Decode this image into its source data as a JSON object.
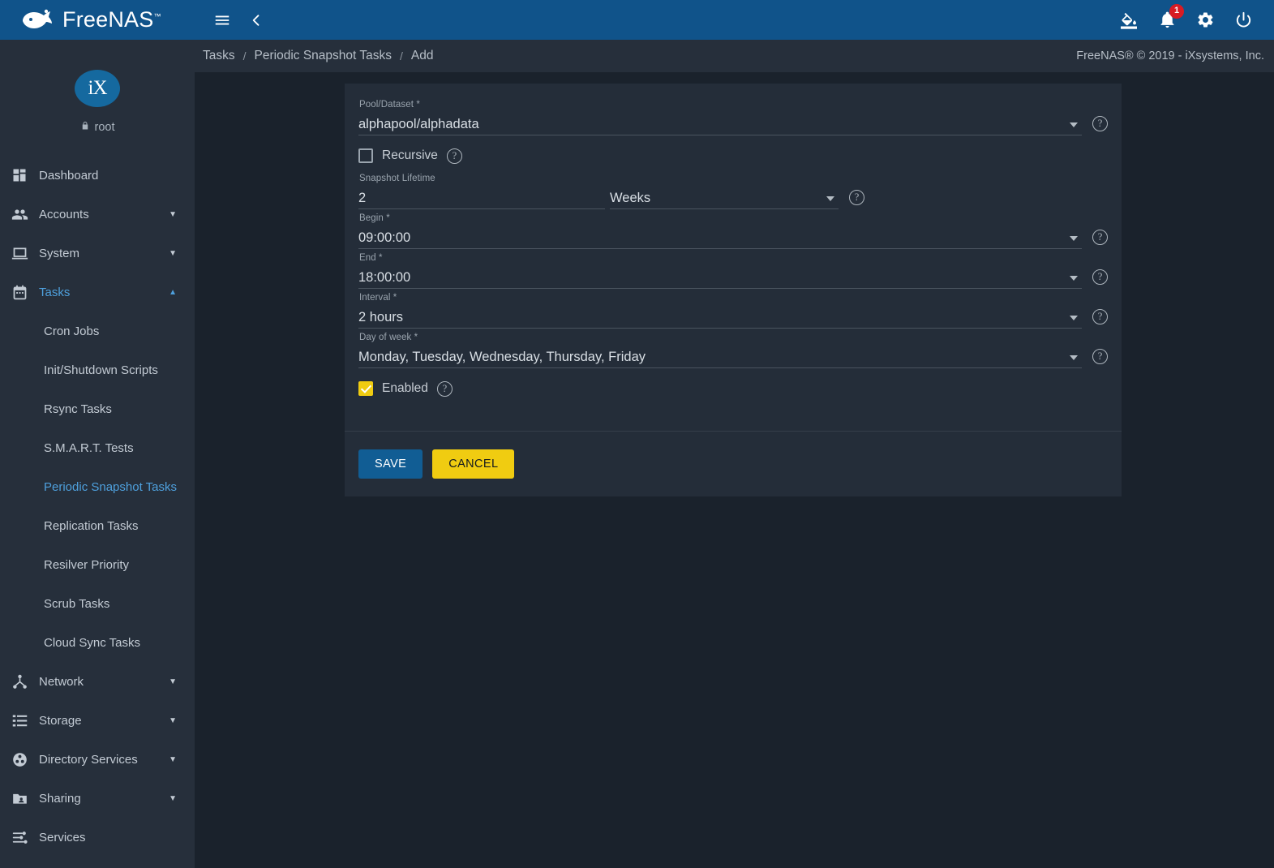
{
  "topbar": {
    "brand_name": "FreeNAS",
    "brand_tm": "™",
    "menu_icon": "hamburger-menu-icon",
    "back_icon": "chevron-left-icon",
    "theme_icon": "format-color-fill-icon",
    "notifications_icon": "bell-icon",
    "notifications_count": "1",
    "settings_icon": "gear-icon",
    "power_icon": "power-icon"
  },
  "sidebar": {
    "avatar_text": "iX",
    "username": "root",
    "lock_icon": "lock-icon",
    "items": [
      {
        "label": "Dashboard",
        "icon": "dashboard-icon",
        "expandable": false,
        "active": false
      },
      {
        "label": "Accounts",
        "icon": "people-icon",
        "expandable": true,
        "active": false
      },
      {
        "label": "System",
        "icon": "laptop-icon",
        "expandable": true,
        "active": false
      },
      {
        "label": "Tasks",
        "icon": "calendar-icon",
        "expandable": true,
        "active": true
      }
    ],
    "task_subitems": [
      {
        "label": "Cron Jobs",
        "active": false
      },
      {
        "label": "Init/Shutdown Scripts",
        "active": false
      },
      {
        "label": "Rsync Tasks",
        "active": false
      },
      {
        "label": "S.M.A.R.T. Tests",
        "active": false
      },
      {
        "label": "Periodic Snapshot Tasks",
        "active": true
      },
      {
        "label": "Replication Tasks",
        "active": false
      },
      {
        "label": "Resilver Priority",
        "active": false
      },
      {
        "label": "Scrub Tasks",
        "active": false
      },
      {
        "label": "Cloud Sync Tasks",
        "active": false
      }
    ],
    "items_after": [
      {
        "label": "Network",
        "icon": "network-icon",
        "expandable": true,
        "active": false
      },
      {
        "label": "Storage",
        "icon": "storage-icon",
        "expandable": true,
        "active": false
      },
      {
        "label": "Directory Services",
        "icon": "directory-services-icon",
        "expandable": true,
        "active": false
      },
      {
        "label": "Sharing",
        "icon": "sharing-folder-icon",
        "expandable": true,
        "active": false
      },
      {
        "label": "Services",
        "icon": "sliders-icon",
        "expandable": false,
        "active": false
      }
    ]
  },
  "breadcrumb": {
    "items": [
      "Tasks",
      "Periodic Snapshot Tasks",
      "Add"
    ],
    "separator": "/"
  },
  "copyright": "FreeNAS® © 2019 - iXsystems, Inc.",
  "form": {
    "pool_dataset": {
      "label": "Pool/Dataset *",
      "value": "alphapool/alphadata"
    },
    "recursive": {
      "label": "Recursive",
      "checked": false
    },
    "snapshot_lifetime": {
      "label": "Snapshot Lifetime",
      "value": "2",
      "unit": "Weeks"
    },
    "begin": {
      "label": "Begin *",
      "value": "09:00:00"
    },
    "end": {
      "label": "End *",
      "value": "18:00:00"
    },
    "interval": {
      "label": "Interval *",
      "value": "2 hours"
    },
    "day_of_week": {
      "label": "Day of week *",
      "value": "Monday, Tuesday, Wednesday, Thursday, Friday"
    },
    "enabled": {
      "label": "Enabled",
      "checked": true
    },
    "help_glyph": "?",
    "save_label": "SAVE",
    "cancel_label": "CANCEL"
  },
  "colors": {
    "topbar": "#10538a",
    "sidebar": "#262f3b",
    "content_bg": "#1a222c",
    "card_bg": "#242d39",
    "accent_blue": "#4ea0dd",
    "save_blue": "#115d94",
    "cancel_yellow": "#f0cc11",
    "badge_red": "#d81b23"
  }
}
